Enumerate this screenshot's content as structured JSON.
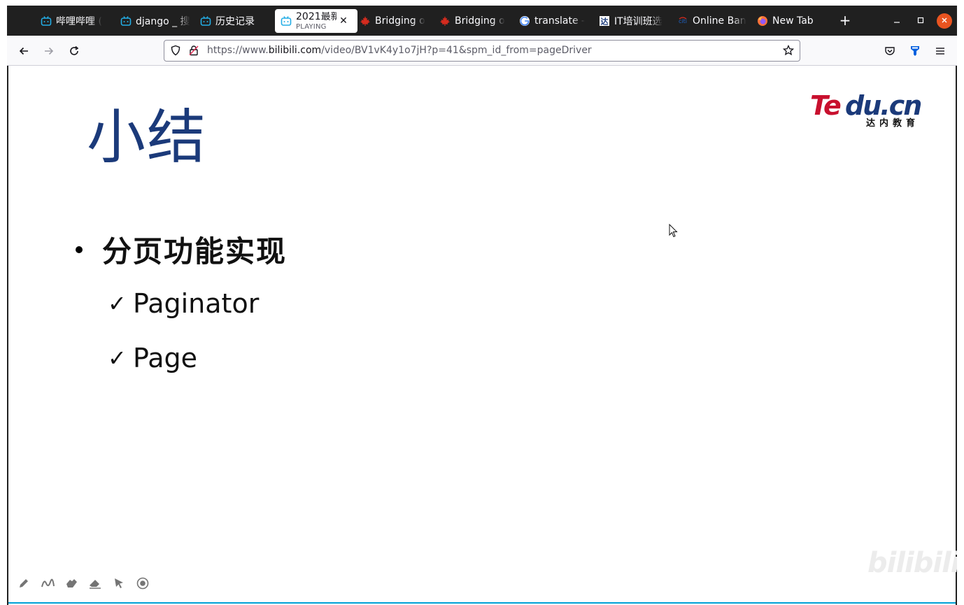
{
  "browser": {
    "tabs": [
      {
        "label": "哔哩哔哩 (",
        "icon": "bilibili-icon"
      },
      {
        "label": "django _ 搜",
        "icon": "bilibili-icon"
      },
      {
        "label": "历史记录",
        "icon": "bilibili-icon"
      },
      {
        "label": "2021最新",
        "sublabel": "PLAYING",
        "icon": "bilibili-icon",
        "active": true
      },
      {
        "label": "Bridging o",
        "icon": "maple-leaf-icon"
      },
      {
        "label": "Bridging o",
        "icon": "maple-leaf-icon"
      },
      {
        "label": "translate -",
        "icon": "google-icon"
      },
      {
        "label": "IT培训班选",
        "icon": "tedu-icon"
      },
      {
        "label": "Online Ban",
        "icon": "citi-icon"
      },
      {
        "label": "New Tab",
        "icon": "firefox-icon"
      }
    ],
    "new_tab_label": "+",
    "url": {
      "prefix": "https://www.",
      "host": "bilibili.com",
      "path": "/video/BV1vK4y1o7jH?p=41&spm_id_from=pageDriver"
    },
    "colors": {
      "tabstrip": "#202020",
      "close_button": "#e95420",
      "accent_blue": "#0060df"
    }
  },
  "slide": {
    "title": "小结",
    "logo": {
      "brand": "Tedu.cn",
      "subtitle": "达内教育"
    },
    "bullet": "分页功能实现",
    "sub_items": [
      "Paginator",
      "Page"
    ],
    "watermark": "bilibili",
    "title_color": "#1b3a7a"
  },
  "player_tools": [
    "pen-icon",
    "curve-icon",
    "hand-icon",
    "eraser-icon",
    "pointer-icon",
    "record-icon"
  ]
}
